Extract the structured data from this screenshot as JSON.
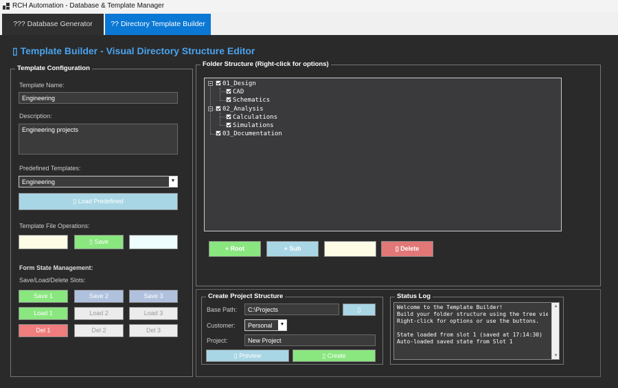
{
  "window": {
    "title": "RCH Automation - Database & Template Manager"
  },
  "tabs": [
    {
      "label": "??? Database Generator"
    },
    {
      "label": "?? Directory Template Builder"
    }
  ],
  "heading": "▯ Template Builder - Visual Directory Structure Editor",
  "config": {
    "legend": "Template Configuration",
    "name_label": "Template Name:",
    "name_value": "Engineering",
    "description_label": "Description:",
    "description_value": "Engineering projects",
    "predefined_label": "Predefined Templates:",
    "predefined_value": "Engineering",
    "load_predefined_button": "▯ Load  Predefined",
    "file_ops_label": "Template File Operations:",
    "file_ops_buttons": [
      "",
      "▯ Save",
      ""
    ],
    "state_heading": "Form State Management:",
    "slots_label": "Save/Load/Delete Slots:",
    "save_slots": [
      "Save 1",
      "Save 2",
      "Save 3"
    ],
    "load_slots": [
      "Load 1",
      "Load 2",
      "Load 3"
    ],
    "delete_slots": [
      "Del 1",
      "Del 2",
      "Del 3"
    ]
  },
  "folders": {
    "legend": "Folder Structure (Right-click for options)",
    "tree": [
      {
        "label": "01_Design"
      },
      {
        "label": "CAD"
      },
      {
        "label": "Schematics"
      },
      {
        "label": "02_Analysis"
      },
      {
        "label": "Calculations"
      },
      {
        "label": "Simulations"
      },
      {
        "label": "03_Documentation"
      }
    ],
    "buttons": {
      "root": "+ Root",
      "sub": "+ Sub",
      "rename": "",
      "delete": "▯ Delete"
    }
  },
  "project": {
    "legend": "Create Project Structure",
    "base_path_label": "Base Path:",
    "base_path_value": "C:\\Projects",
    "browse_button": "▯",
    "customer_label": "Customer:",
    "customer_value": "Personal",
    "project_label": "Project:",
    "project_value": "New Project",
    "preview_button": "▯ Preview",
    "create_button": "▯ Create"
  },
  "status": {
    "legend": "Status Log",
    "lines": [
      "Welcome to the Template Builder!",
      "Build your folder structure using the tree view.",
      "Right-click for options or use the buttons.",
      "",
      "State loaded from slot 1 (saved at 17:14:30)",
      "Auto-loaded saved state from Slot 1"
    ]
  },
  "colors": {
    "accent": "#0a78d4",
    "heading": "#4aa3ee",
    "background": "#2a2a2a",
    "green_button": "#8ae67f",
    "blue_button": "#a9d6e5",
    "red_button": "#f07d7d"
  }
}
